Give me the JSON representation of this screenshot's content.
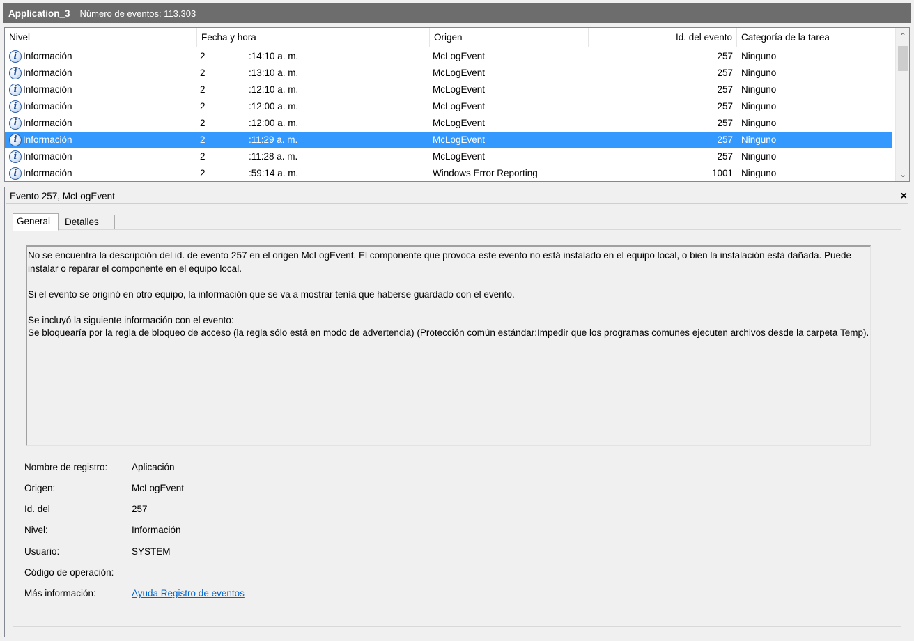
{
  "window": {
    "log_name": "Application_3",
    "event_count": "Número de eventos: 113.303"
  },
  "grid": {
    "columns": {
      "level": "Nivel",
      "date": "Fecha y hora",
      "source": "Origen",
      "event_id": "Id. del evento",
      "category": "Categoría de la tarea"
    },
    "rows": [
      {
        "level": "Información",
        "date_a": "2",
        "date_b": ":14:10 a. m.",
        "source": "McLogEvent",
        "event_id": "257",
        "category": "Ninguno"
      },
      {
        "level": "Información",
        "date_a": "2",
        "date_b": ":13:10 a. m.",
        "source": "McLogEvent",
        "event_id": "257",
        "category": "Ninguno"
      },
      {
        "level": "Información",
        "date_a": "2",
        "date_b": ":12:10 a. m.",
        "source": "McLogEvent",
        "event_id": "257",
        "category": "Ninguno"
      },
      {
        "level": "Información",
        "date_a": "2",
        "date_b": ":12:00 a. m.",
        "source": "McLogEvent",
        "event_id": "257",
        "category": "Ninguno"
      },
      {
        "level": "Información",
        "date_a": "2",
        "date_b": ":12:00 a. m.",
        "source": "McLogEvent",
        "event_id": "257",
        "category": "Ninguno"
      },
      {
        "level": "Información",
        "date_a": "2",
        "date_b": ":11:29 a. m.",
        "source": "McLogEvent",
        "event_id": "257",
        "category": "Ninguno"
      },
      {
        "level": "Información",
        "date_a": "2",
        "date_b": ":11:28 a. m.",
        "source": "McLogEvent",
        "event_id": "257",
        "category": "Ninguno"
      },
      {
        "level": "Información",
        "date_a": "2",
        "date_b": ":59:14 a. m.",
        "source": "Windows Error Reporting",
        "event_id": "1001",
        "category": "Ninguno"
      }
    ],
    "selected_row_index": 5,
    "info_icon_glyph": "i",
    "scroll_up_glyph": "⌃",
    "scroll_down_glyph": "⌄"
  },
  "detail": {
    "title": "Evento 257, McLogEvent",
    "close_glyph": "×",
    "tabs": {
      "general": "General",
      "details": "Detalles"
    },
    "description": {
      "p1": "No se encuentra la descripción del id. de evento 257 en el origen McLogEvent. El componente que provoca este evento no está instalado en el equipo local, o bien la instalación está dañada. Puede instalar o reparar el componente en el equipo local.",
      "p2": "Si el evento se originó en otro equipo, la información que se va a mostrar tenía que haberse guardado con el evento.",
      "p3_line1": "Se incluyó la siguiente información con el evento:",
      "p3_line2": "Se bloquearía por la regla de bloqueo de acceso (la regla sólo está en modo de advertencia) (Protección común estándar:Impedir que los programas comunes ejecuten archivos desde la carpeta Temp)."
    },
    "props": {
      "log_name_label": "Nombre de registro:",
      "log_name_value": "Aplicación",
      "source_label": "Origen:",
      "source_value": "McLogEvent",
      "id_label": "Id. del",
      "id_value": "257",
      "level_label": "Nivel:",
      "level_value": "Información",
      "user_label": "Usuario:",
      "user_value": "SYSTEM",
      "opcode_label": "Código de operación:",
      "more_info_label": "Más información:",
      "more_info_link": "Ayuda Registro de eventos"
    }
  },
  "colors": {
    "selection": "#3399ff",
    "titlebar": "#6d6d6d",
    "link": "#0066cc"
  }
}
